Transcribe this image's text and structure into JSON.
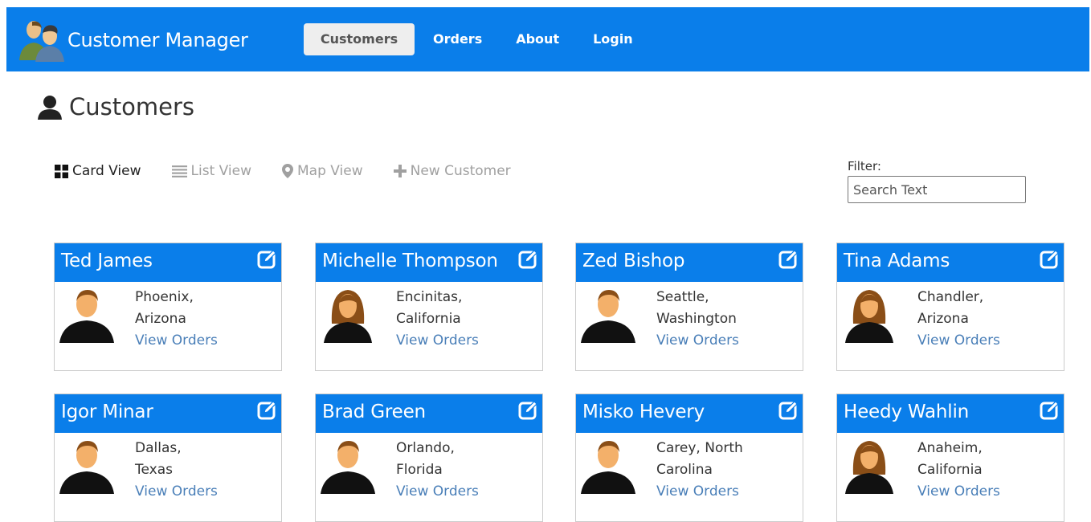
{
  "app": {
    "brand": "Customer Manager"
  },
  "nav": [
    {
      "label": "Customers",
      "active": true
    },
    {
      "label": "Orders",
      "active": false
    },
    {
      "label": "About",
      "active": false
    },
    {
      "label": "Login",
      "active": false
    }
  ],
  "page": {
    "title": "Customers"
  },
  "toolbar": {
    "card_view": "Card View",
    "list_view": "List View",
    "map_view": "Map View",
    "new_customer": "New Customer"
  },
  "filter": {
    "label": "Filter:",
    "placeholder": "Search Text"
  },
  "customers": [
    {
      "name": "Ted James",
      "city": "Phoenix, Arizona",
      "gender": "male",
      "link": "View Orders"
    },
    {
      "name": "Michelle Thompson",
      "city": "Encinitas, California",
      "gender": "female",
      "link": "View Orders"
    },
    {
      "name": "Zed Bishop",
      "city": "Seattle, Washington",
      "gender": "male",
      "link": "View Orders"
    },
    {
      "name": "Tina Adams",
      "city": "Chandler, Arizona",
      "gender": "female",
      "link": "View Orders"
    },
    {
      "name": "Igor Minar",
      "city": "Dallas, Texas",
      "gender": "male",
      "link": "View Orders"
    },
    {
      "name": "Brad Green",
      "city": "Orlando, Florida",
      "gender": "male",
      "link": "View Orders"
    },
    {
      "name": "Misko Hevery",
      "city": "Carey, North Carolina",
      "gender": "male",
      "link": "View Orders"
    },
    {
      "name": "Heedy Wahlin",
      "city": "Anaheim, California",
      "gender": "female",
      "link": "View Orders"
    }
  ],
  "colors": {
    "primary": "#0a7eea",
    "link": "#4a7fb8",
    "muted": "#a0a0a0"
  }
}
